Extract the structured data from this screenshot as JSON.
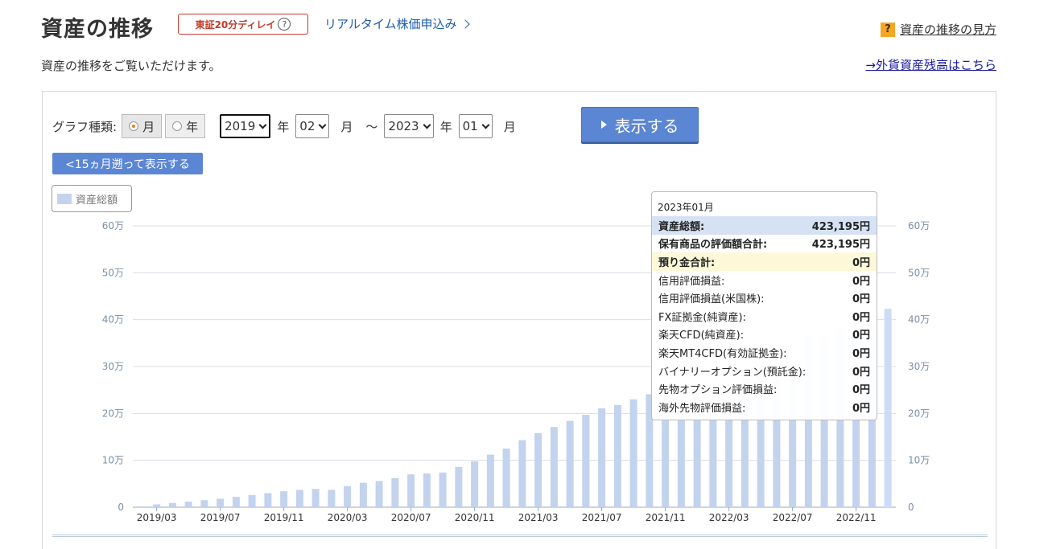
{
  "header": {
    "title": "資産の推移",
    "delay_badge": "東証20分ディレイ",
    "realtime_link": "リアルタイム株価申込み",
    "howto_link": "資産の推移の見方",
    "subtitle": "資産の推移をご覧いただけます。",
    "fx_link": "→外貨資産残高はこちら"
  },
  "controls": {
    "graph_type_label": "グラフ種類:",
    "monthly_label": "月",
    "yearly_label": "年",
    "selected_type": "月",
    "from_year": "2019",
    "from_month": "02",
    "to_year": "2023",
    "to_month": "01",
    "year_unit": "年",
    "month_unit": "月",
    "range_sep": "〜",
    "show_button": "表示する",
    "back_button": "<15ヵ月遡って表示する"
  },
  "legend": {
    "label": "資産総額"
  },
  "tooltip": {
    "date": "2023年01月",
    "rows": [
      {
        "label": "資産総額:",
        "value": "423,195円"
      },
      {
        "label": "保有商品の評価額合計:",
        "value": "423,195円"
      },
      {
        "label": "預り金合計:",
        "value": "0円"
      },
      {
        "label": "信用評価損益:",
        "value": "0円"
      },
      {
        "label": "信用評価損益(米国株):",
        "value": "0円"
      },
      {
        "label": "FX証拠金(純資産):",
        "value": "0円"
      },
      {
        "label": "楽天CFD(純資産):",
        "value": "0円"
      },
      {
        "label": "楽天MT4CFD(有効証拠金):",
        "value": "0円"
      },
      {
        "label": "バイナリーオプション(預託金):",
        "value": "0円"
      },
      {
        "label": "先物オプション評価損益:",
        "value": "0円"
      },
      {
        "label": "海外先物評価損益:",
        "value": "0円"
      }
    ]
  },
  "colors": {
    "bar": "#c3d3ee",
    "bar_highlight": "#cddcf6",
    "grid": "#d8dde6",
    "button": "#5b86d4"
  },
  "chart_data": {
    "type": "bar",
    "series": [
      {
        "name": "資産総額"
      }
    ],
    "categories": [
      "2019/02",
      "2019/03",
      "2019/04",
      "2019/05",
      "2019/06",
      "2019/07",
      "2019/08",
      "2019/09",
      "2019/10",
      "2019/11",
      "2019/12",
      "2020/01",
      "2020/02",
      "2020/03",
      "2020/04",
      "2020/05",
      "2020/06",
      "2020/07",
      "2020/08",
      "2020/09",
      "2020/10",
      "2020/11",
      "2020/12",
      "2021/01",
      "2021/02",
      "2021/03",
      "2021/04",
      "2021/05",
      "2021/06",
      "2021/07",
      "2021/08",
      "2021/09",
      "2021/10",
      "2021/11",
      "2021/12",
      "2022/01",
      "2022/02",
      "2022/03",
      "2022/04",
      "2022/05",
      "2022/06",
      "2022/07",
      "2022/08",
      "2022/09",
      "2022/10",
      "2022/11",
      "2022/12",
      "2023/01"
    ],
    "values": [
      2000,
      6000,
      9000,
      12000,
      15000,
      18000,
      22000,
      26000,
      30000,
      34000,
      37000,
      39000,
      37000,
      45000,
      52000,
      56000,
      62000,
      70000,
      72000,
      74000,
      86000,
      98000,
      112000,
      125000,
      143000,
      158000,
      171000,
      184000,
      197000,
      211000,
      218000,
      230000,
      241000,
      240000,
      245000,
      250000,
      255000,
      265000,
      275000,
      290000,
      300000,
      310000,
      370000,
      362000,
      380000,
      395000,
      390000,
      423195
    ],
    "x_tick_labels": [
      "2019/03",
      "2019/07",
      "2019/11",
      "2020/03",
      "2020/07",
      "2020/11",
      "2021/03",
      "2021/07",
      "2021/11",
      "2022/03",
      "2022/07",
      "2022/11"
    ],
    "y_tick_labels": [
      "0",
      "10万",
      "20万",
      "30万",
      "40万",
      "50万",
      "60万"
    ],
    "ylim": [
      0,
      600000
    ],
    "highlight_index": 47,
    "grid": true,
    "legend_position": "top-left"
  }
}
